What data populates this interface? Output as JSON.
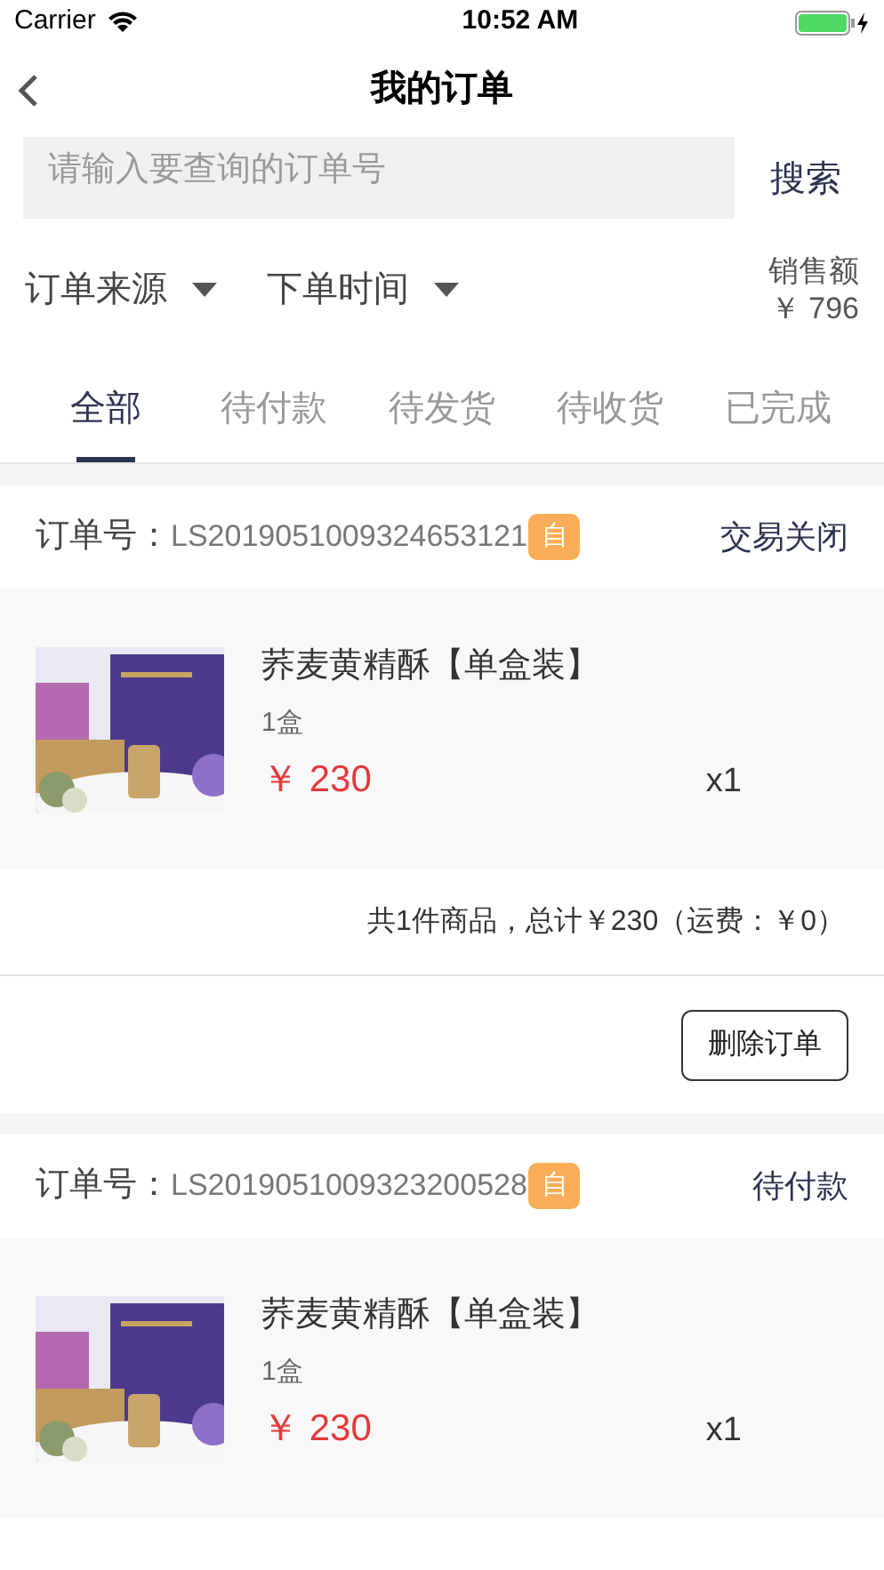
{
  "status_bar": {
    "carrier": "Carrier",
    "time": "10:52 AM"
  },
  "nav": {
    "title": "我的订单"
  },
  "search": {
    "placeholder": "请输入要查询的订单号",
    "button": "搜索"
  },
  "filters": [
    {
      "label": "订单来源"
    },
    {
      "label": "下单时间"
    }
  ],
  "sales": {
    "label": "销售额",
    "value": "￥ 796"
  },
  "tabs": [
    {
      "label": "全部",
      "selected": true
    },
    {
      "label": "待付款",
      "selected": false
    },
    {
      "label": "待发货",
      "selected": false
    },
    {
      "label": "待收货",
      "selected": false
    },
    {
      "label": "已完成",
      "selected": false
    }
  ],
  "orders": [
    {
      "number_label": "订单号：",
      "number": "LS2019051009324653121",
      "badge": "自",
      "status": "交易关闭",
      "product": {
        "kind": "picture",
        "name": "荞麦黄精酥【单盒装】",
        "spec": "1盒",
        "price": "￥ 230",
        "quantity": "x1"
      },
      "summary": "共1件商品，总计￥230（运费：￥0）",
      "actions": [
        "删除订单"
      ]
    },
    {
      "number_label": "订单号：",
      "number": "LS2019051009323200528",
      "badge": "自",
      "status": "待付款",
      "product": {
        "kind": "picture",
        "name": "荞麦黄精酥【单盒装】",
        "spec": "1盒",
        "price": "￥ 230",
        "quantity": "x1"
      }
    }
  ]
}
